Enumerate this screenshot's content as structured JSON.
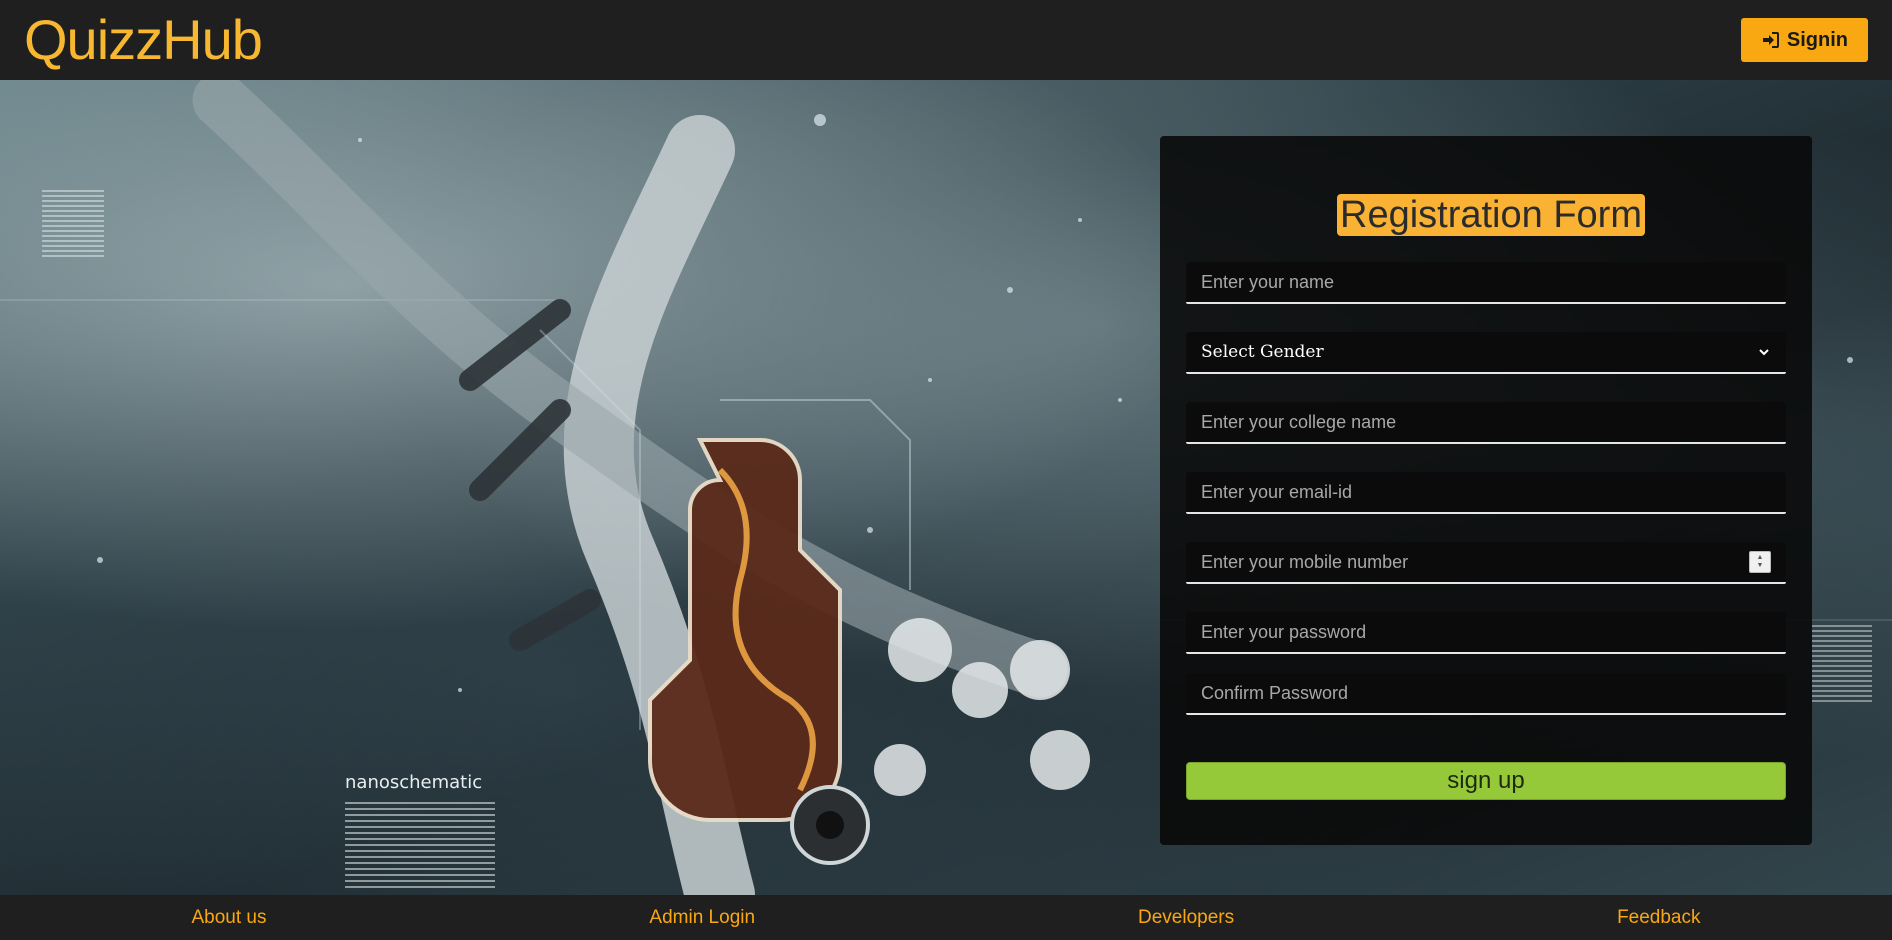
{
  "header": {
    "logo": "QuizzHub",
    "signin_label": "Signin"
  },
  "hero": {
    "watermark": "nanoschematic"
  },
  "form": {
    "title": "Registration Form",
    "name_placeholder": "Enter your name",
    "gender_selected": "Select Gender",
    "college_placeholder": "Enter your college name",
    "email_placeholder": "Enter your email-id",
    "mobile_placeholder": "Enter your mobile number",
    "password_placeholder": "Enter your password",
    "confirm_placeholder": "Confirm Password",
    "submit_label": "sign up"
  },
  "footer": {
    "links": [
      "About us",
      "Admin Login",
      "Developers",
      "Feedback"
    ]
  },
  "colors": {
    "accent": "#f9a812",
    "submit": "#95c93a",
    "header_bg": "#1f1f1f"
  },
  "icons": {
    "signin": "sign-in-icon",
    "select": "chevron-down-icon",
    "spinner": "number-spinner-icon"
  }
}
